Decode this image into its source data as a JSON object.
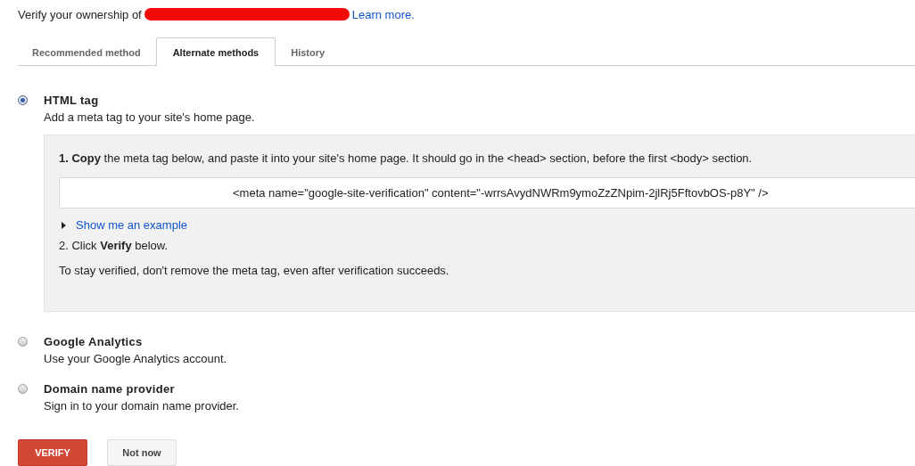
{
  "intro": {
    "text": "Verify your ownership of",
    "link": "Learn more."
  },
  "tabs": [
    {
      "label": "Recommended method",
      "selected": false
    },
    {
      "label": "Alternate methods",
      "selected": true
    },
    {
      "label": "History",
      "selected": false
    }
  ],
  "methods": [
    {
      "title": "HTML tag",
      "description": "Add a meta tag to your site's home page.",
      "selected": true,
      "details": {
        "step_1": "**1. Copy** the meta tag below, and paste it into your site's home page. It should go in the <head> section, before the first <body> section.",
        "meta_tag": "<meta name=\"google-site-verification\" content=\"-wrrsAvydNWRm9ymoZzZNpim-2jlRj5FftovbOS-p8Y\" />",
        "example_link": "Show me an example",
        "step_2": "2. Click **Verify** below.",
        "note": "To stay verified, don't remove the meta tag, even after verification succeeds."
      }
    },
    {
      "title": "Google Analytics",
      "description": "Use your Google Analytics account.",
      "selected": false
    },
    {
      "title": "Domain name provider",
      "description": "Sign in to your domain name provider.",
      "selected": false
    }
  ],
  "buttons": [
    {
      "label": "VERIFY",
      "kind": "primary"
    },
    {
      "label": "Not now",
      "kind": "secondary"
    }
  ]
}
